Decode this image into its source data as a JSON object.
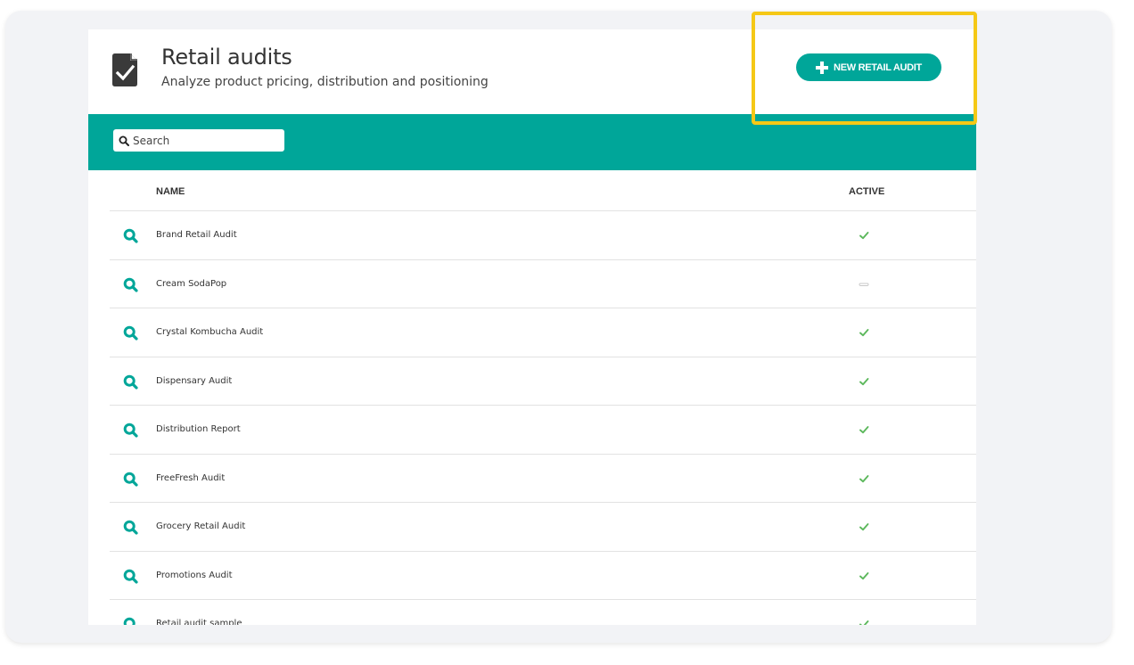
{
  "header": {
    "title": "Retail audits",
    "subtitle": "Analyze product pricing, distribution and positioning",
    "icon": "document-check-icon"
  },
  "toolbar": {
    "new_button_label": "NEW RETAIL AUDIT",
    "search_placeholder": "Search"
  },
  "table": {
    "columns": [
      "NAME",
      "ACTIVE"
    ],
    "rows": [
      {
        "name": "Brand Retail Audit",
        "active": true
      },
      {
        "name": "Cream SodaPop",
        "active": false
      },
      {
        "name": "Crystal Kombucha Audit",
        "active": true
      },
      {
        "name": "Dispensary Audit",
        "active": true
      },
      {
        "name": "Distribution Report",
        "active": true
      },
      {
        "name": "FreeFresh Audit",
        "active": true
      },
      {
        "name": "Grocery Retail Audit",
        "active": true
      },
      {
        "name": "Promotions Audit",
        "active": true
      },
      {
        "name": "Retail audit sample",
        "active": true
      }
    ]
  },
  "colors": {
    "accent": "#00a699",
    "highlight": "#f5c816",
    "check": "#5cb85c"
  }
}
